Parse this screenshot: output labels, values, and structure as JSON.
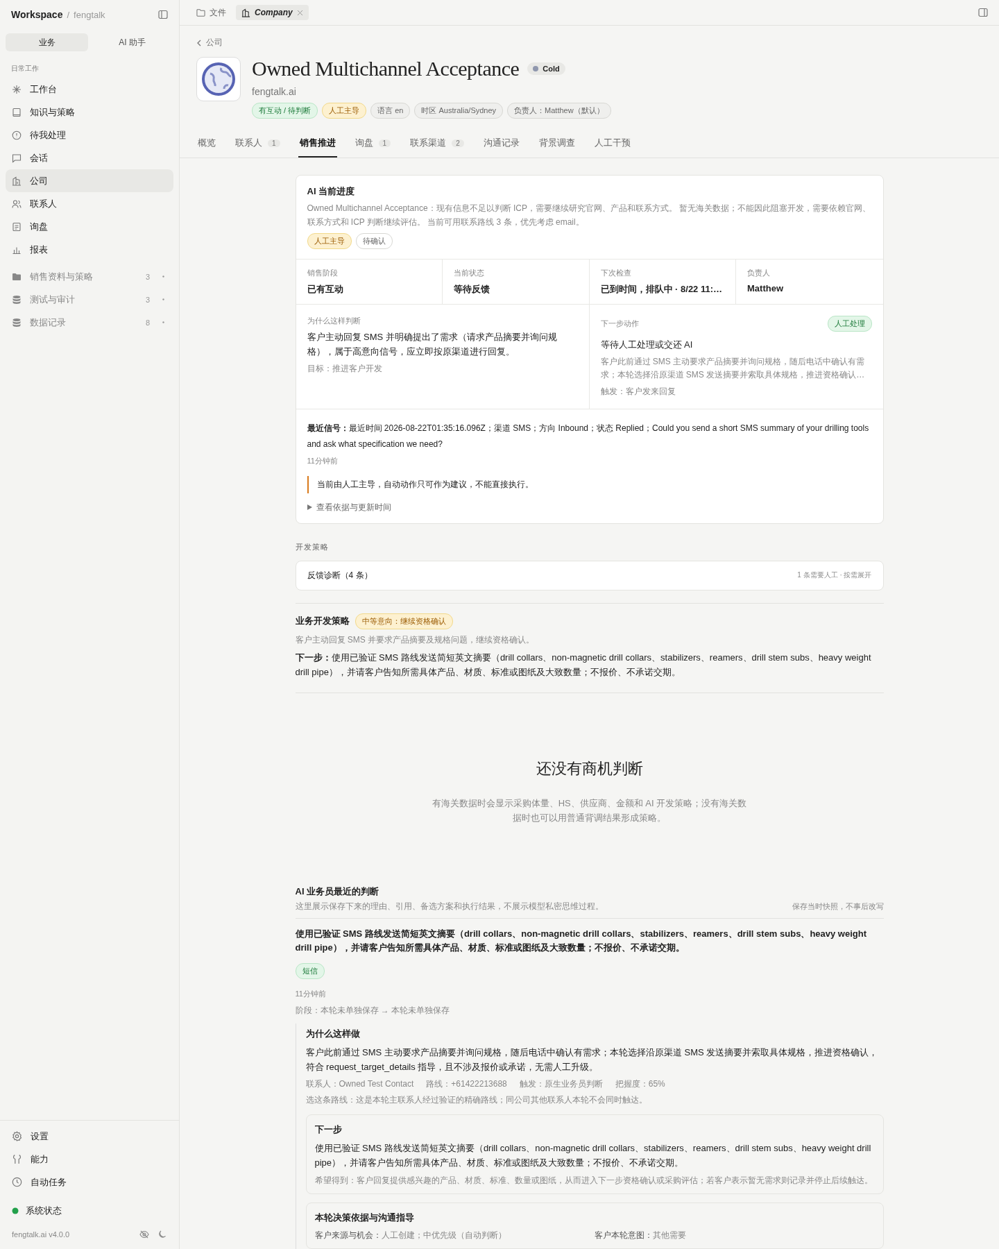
{
  "sidebar": {
    "workspace": "Workspace",
    "separator": "/",
    "org": "fengtalk",
    "mode_tabs": [
      {
        "label": "业务",
        "selected": true
      },
      {
        "label": "AI 助手",
        "selected": false
      }
    ],
    "section": "日常工作",
    "nav": [
      {
        "label": "工作台",
        "selected": false
      },
      {
        "label": "知识与策略",
        "selected": false
      },
      {
        "label": "待我处理",
        "selected": false
      },
      {
        "label": "会话",
        "selected": false
      },
      {
        "label": "公司",
        "selected": true
      },
      {
        "label": "联系人",
        "selected": false
      },
      {
        "label": "询盘",
        "selected": false
      },
      {
        "label": "报表",
        "selected": false
      }
    ],
    "folders": [
      {
        "label": "销售资料与策略",
        "count": "3"
      },
      {
        "label": "测试与审计",
        "count": "3"
      },
      {
        "label": "数据记录",
        "count": "8"
      }
    ],
    "bottom": [
      {
        "label": "设置"
      },
      {
        "label": "能力"
      },
      {
        "label": "自动任务"
      }
    ],
    "status": {
      "label": "系统状态",
      "color": "#22a04b"
    },
    "version": "fengtalk.ai v4.0.0"
  },
  "doc_tabs": [
    {
      "label": "文件",
      "selected": false,
      "closable": false
    },
    {
      "label": "Company",
      "selected": true,
      "closable": true
    }
  ],
  "company": {
    "back": "公司",
    "name": "Owned Multichannel Acceptance",
    "temperature": "Cold",
    "domain": "fengtalk.ai",
    "tags": [
      {
        "label": "有互动 / 待判断",
        "kind": "success"
      },
      {
        "label": "人工主导",
        "kind": "warning"
      },
      {
        "label": "语言 en",
        "kind": "neutral"
      },
      {
        "label": "时区 Australia/Sydney",
        "kind": "neutral"
      },
      {
        "label": "负责人：Matthew（默认）",
        "kind": "neutral"
      }
    ]
  },
  "tabs": [
    {
      "label": "概览",
      "selected": false
    },
    {
      "label": "联系人",
      "count": "1",
      "selected": false
    },
    {
      "label": "销售推进",
      "selected": true
    },
    {
      "label": "询盘",
      "count": "1",
      "selected": false
    },
    {
      "label": "联系渠道",
      "count": "2",
      "selected": false
    },
    {
      "label": "沟通记录",
      "selected": false
    },
    {
      "label": "背景调查",
      "selected": false
    },
    {
      "label": "人工干预",
      "selected": false
    }
  ],
  "progress": {
    "title": "AI 当前进度",
    "summary": "Owned Multichannel Acceptance：现有信息不足以判断 ICP，需要继续研究官网、产品和联系方式。 暂无海关数据；不能因此阻塞开发，需要依赖官网、联系方式和 ICP 判断继续评估。 当前可用联系路线 3 条，优先考虑 email。",
    "tags": [
      {
        "label": "人工主导",
        "kind": "warning"
      },
      {
        "label": "待确认",
        "kind": "neutral"
      }
    ],
    "facts": [
      {
        "label": "销售阶段",
        "value": "已有互动"
      },
      {
        "label": "当前状态",
        "value": "等待反馈"
      },
      {
        "label": "下次检查",
        "value": "已到时间，排队中 · 8/22 11:…"
      },
      {
        "label": "负责人",
        "value": "Matthew"
      }
    ],
    "why": {
      "label": "为什么这样判断",
      "text": "客户主动回复 SMS 并明确提出了需求（请求产品摘要并询问规格），属于高意向信号，应立即按原渠道进行回复。",
      "goal": "目标：推进客户开发"
    },
    "next": {
      "label": "下一步动作",
      "badge": "人工处理",
      "title": "等待人工处理或交还 AI",
      "text": "客户此前通过 SMS 主动要求产品摘要并询问规格，随后电话中确认有需求；本轮选择沿原渠道 SMS 发送摘要并索取具体规格，推进资格确认…",
      "trigger": "触发：客户发来回复"
    },
    "signal": {
      "text": "**最近信号：**最近时间 2026-08-22T01:35:16.096Z；渠道 SMS；方向 Inbound；状态 Replied；Could you send a short SMS summary of your drilling tools and ask what specification we need?",
      "time": "11分钟前"
    },
    "notice": "当前由人工主导，自动动作只可作为建议，不能直接执行。",
    "details": {
      "label": "查看依据与更新时间",
      "expanded": false
    }
  },
  "strategy_label": "开发策略",
  "feedback": {
    "title": "反馈诊断（4 条）",
    "note": "1 条需要人工 · 按需展开"
  },
  "strategy": {
    "title": "业务开发策略",
    "badge": "中等意向：继续资格确认",
    "summary": "客户主动回复 SMS 并要求产品摘要及规格问题，继续资格确认。",
    "next": "**下一步：**使用已验证 SMS 路线发送简短英文摘要（drill collars、non-magnetic drill collars、stabilizers、reamers、drill stem subs、heavy weight drill pipe），并请客户告知所需具体产品、材质、标准或图纸及大致数量；不报价、不承诺交期。"
  },
  "empty": {
    "title": "还没有商机判断",
    "text": "有海关数据时会显示采购体量、HS、供应商、金额和 AI 开发策略；没有海关数据时也可以用普通背调结果形成策略。"
  },
  "recent": {
    "title": "AI 业务员最近的判断",
    "subtitle": "这里展示保存下来的理由、引用、备选方案和执行结果，不展示模型私密思维过程。",
    "note": "保存当时快照，不事后改写",
    "decision": "使用已验证 SMS 路线发送简短英文摘要（drill collars、non-magnetic drill collars、stabilizers、reamers、drill stem subs、heavy weight drill pipe），并请客户告知所需具体产品、材质、标准或图纸及大致数量；不报价、不承诺交期。",
    "channel": "短信",
    "time": "11分钟前",
    "stage": "阶段：本轮未单独保存 → 本轮未单独保存",
    "reason": {
      "title": "为什么这样做",
      "text": "客户此前通过 SMS 主动要求产品摘要并询问规格，随后电话中确认有需求；本轮选择沿原渠道 SMS 发送摘要并索取具体规格，推进资格确认，符合 request_target_details 指导，且不涉及报价或承诺，无需人工升级。",
      "meta": [
        "联系人：Owned Test Contact",
        "路线：+61422213688",
        "触发：原生业务员判断",
        "把握度：65%"
      ],
      "route": "选这条路线：这是本轮主联系人经过验证的精确路线；同公司其他联系人本轮不会同时触达。"
    },
    "next_step": {
      "title": "下一步",
      "text": "使用已验证 SMS 路线发送简短英文摘要（drill collars、non-magnetic drill collars、stabilizers、reamers、drill stem subs、heavy weight drill pipe），并请客户告知所需具体产品、材质、标准或图纸及大致数量；不报价、不承诺交期。",
      "hope": "希望得到：客户回复提供感兴趣的产品、材质、标准、数量或图纸，从而进入下一步资格确认或采购评估；若客户表示暂无需求则记录并停止后续触达。"
    },
    "basis": {
      "title": "本轮决策依据与沟通指导",
      "items": [
        {
          "label": "客户来源与机会：",
          "value": "人工创建；中优先级（自动判断）"
        },
        {
          "label": "客户本轮意图：",
          "value": "其他需要"
        }
      ]
    }
  }
}
